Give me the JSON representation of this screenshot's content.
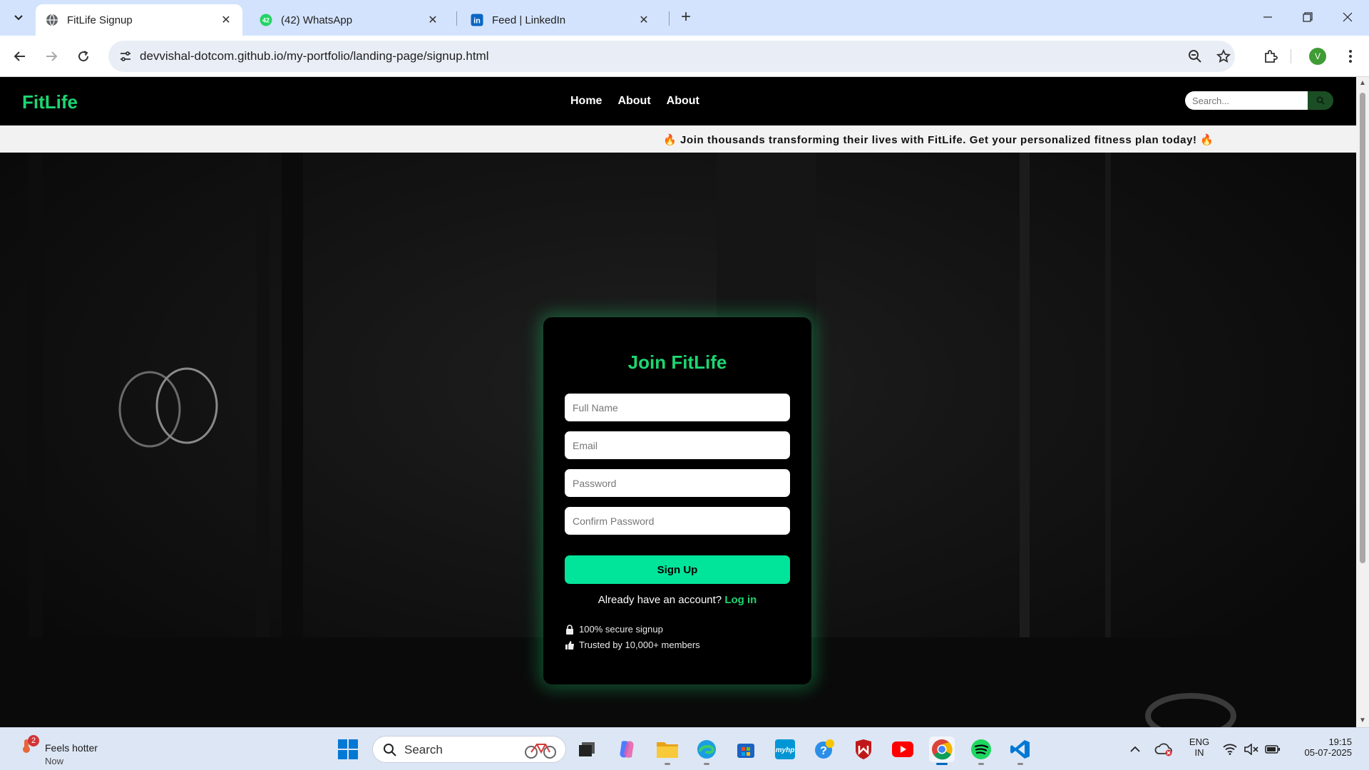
{
  "browser": {
    "tabs": [
      {
        "title": "FitLife Signup",
        "icon": "globe-icon",
        "active": true
      },
      {
        "title": "(42) WhatsApp",
        "icon": "whatsapp-icon",
        "badge": "42",
        "active": false
      },
      {
        "title": "Feed | LinkedIn",
        "icon": "linkedin-icon",
        "active": false
      }
    ],
    "url": "devvishal-dotcom.github.io/my-portfolio/landing-page/signup.html",
    "profile_initial": "V"
  },
  "site": {
    "logo": "FitLife",
    "nav": [
      "Home",
      "About",
      "About"
    ],
    "search_placeholder": "Search...",
    "banner": "🔥 Join thousands transforming their lives with FitLife. Get your personalized fitness plan today! 🔥",
    "colors": {
      "accent": "#1dd672",
      "button": "#00e59a"
    }
  },
  "form": {
    "title": "Join FitLife",
    "fields": [
      {
        "placeholder": "Full Name"
      },
      {
        "placeholder": "Email"
      },
      {
        "placeholder": "Password"
      },
      {
        "placeholder": "Confirm Password"
      }
    ],
    "submit_label": "Sign Up",
    "login_prompt": "Already have an account?",
    "login_link": "Log in",
    "trust": [
      {
        "icon": "lock-icon",
        "text": "100% secure signup"
      },
      {
        "icon": "thumbs-up-icon",
        "text": "Trusted by 10,000+ members"
      }
    ]
  },
  "taskbar": {
    "weather": {
      "badge": "2",
      "line1": "Feels hotter",
      "line2": "Now"
    },
    "search_label": "Search",
    "apps": [
      "start",
      "search",
      "task-view",
      "copilot",
      "file-explorer",
      "edge",
      "store",
      "myhp",
      "help",
      "mcafee",
      "youtube",
      "chrome",
      "spotify",
      "vscode"
    ],
    "lang_line1": "ENG",
    "lang_line2": "IN",
    "time": "19:15",
    "date": "05-07-2025"
  }
}
